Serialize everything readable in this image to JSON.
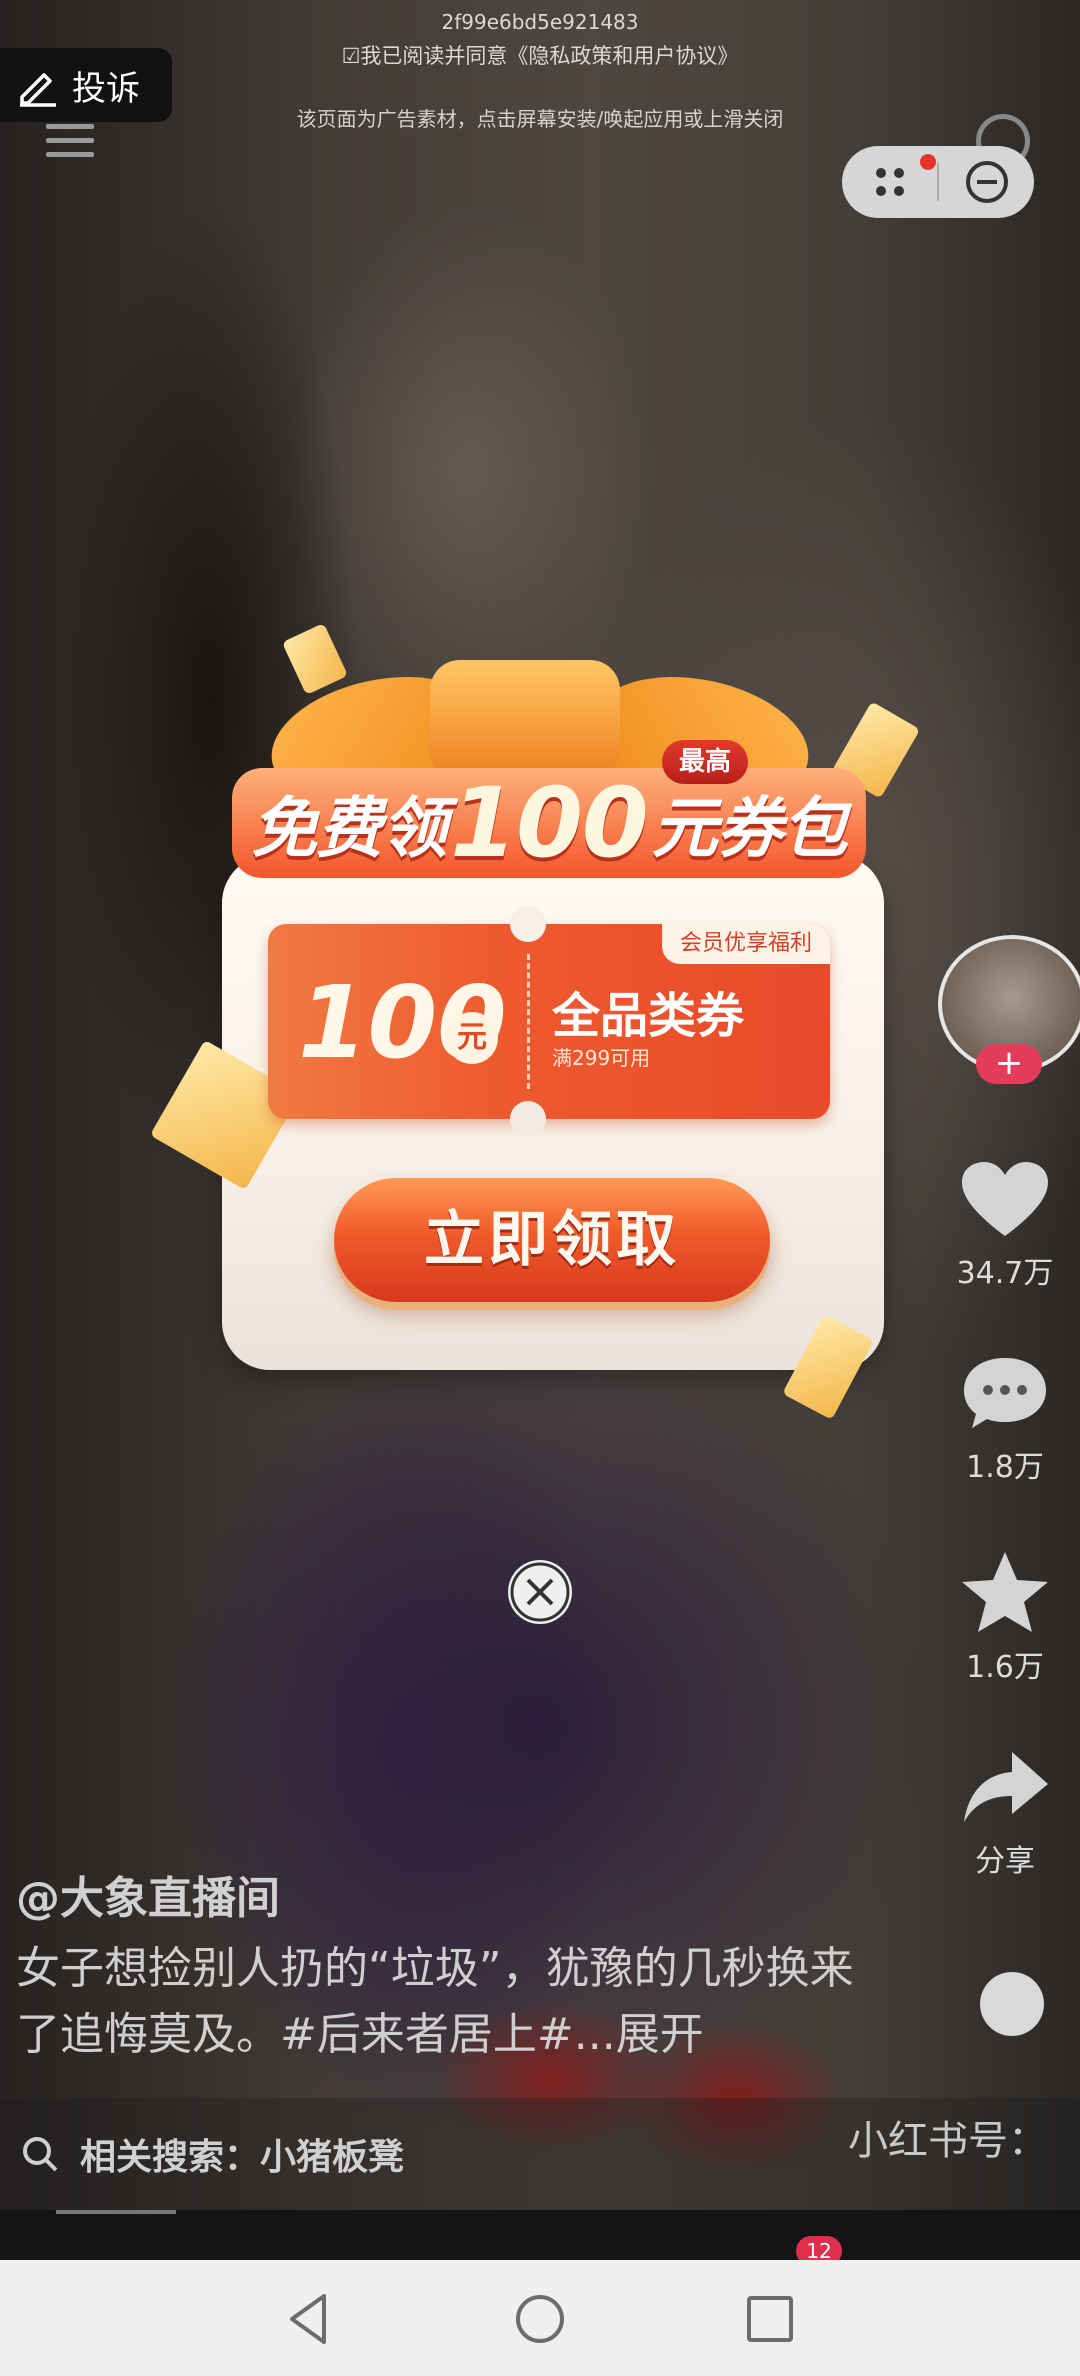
{
  "top": {
    "ad_id": "2f99e6bd5e921483",
    "agreement": "☑我已阅读并同意《隐私政策和用户协议》",
    "ad_notice": "该页面为广告素材，点击屏幕安装/唤起应用或上滑关闭"
  },
  "complain": {
    "label": "投诉"
  },
  "right_rail": {
    "likes": "34.7万",
    "comments": "1.8万",
    "favorites": "1.6万",
    "share": "分享"
  },
  "video": {
    "author": "@大象直播间",
    "caption": "女子想捡别人扔的“垃圾”，犹豫的几秒换来了追悔莫及。#后来者居上#...展开",
    "related_search": "相关搜索：小猪板凳",
    "xiaohongshu": "小红书号：",
    "inbox_badge": "12"
  },
  "popup": {
    "max_tag": "最高",
    "banner_prefix": "免费领",
    "banner_number": "100",
    "banner_suffix": "元券包",
    "coupon_amount": "100",
    "coupon_unit": "元",
    "coupon_title": "全品类券",
    "coupon_condition": "满299可用",
    "member_tag": "会员优享福利",
    "claim_button": "立即领取"
  },
  "colors": {
    "accent": "#f05a2a",
    "badge": "#e02f4d"
  }
}
